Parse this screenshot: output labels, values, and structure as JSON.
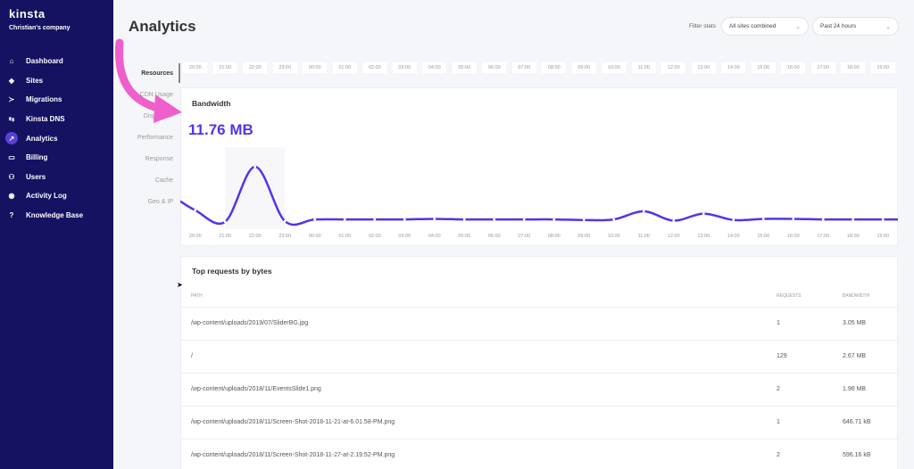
{
  "brand": {
    "logo": "kinsta",
    "company": "Christian's company"
  },
  "sidebar": {
    "items": [
      {
        "label": "Dashboard",
        "icon": "home-icon",
        "glyph": "⌂"
      },
      {
        "label": "Sites",
        "icon": "layers-icon",
        "glyph": "◈"
      },
      {
        "label": "Migrations",
        "icon": "migrate-icon",
        "glyph": "≻"
      },
      {
        "label": "Kinsta DNS",
        "icon": "dns-icon",
        "glyph": "⇆"
      },
      {
        "label": "Analytics",
        "icon": "analytics-icon",
        "glyph": "↗",
        "active": true
      },
      {
        "label": "Billing",
        "icon": "billing-icon",
        "glyph": "▭"
      },
      {
        "label": "Users",
        "icon": "users-icon",
        "glyph": "⚇"
      },
      {
        "label": "Activity Log",
        "icon": "eye-icon",
        "glyph": "◉"
      },
      {
        "label": "Knowledge Base",
        "icon": "help-icon",
        "glyph": "?"
      }
    ]
  },
  "page": {
    "title": "Analytics"
  },
  "filters": {
    "label": "Filter stats",
    "site": "All sites combined",
    "period": "Past 24 hours"
  },
  "subnav": [
    "Resources",
    "CDN Usage",
    "Dispersion",
    "Performance",
    "Response",
    "Cache",
    "Geo & IP"
  ],
  "times": [
    "20:00",
    "21:00",
    "22:00",
    "23:00",
    "00:00",
    "01:00",
    "02:00",
    "03:00",
    "04:00",
    "05:00",
    "06:00",
    "07:00",
    "08:00",
    "09:00",
    "10:00",
    "11:00",
    "12:00",
    "13:00",
    "14:00",
    "15:00",
    "16:00",
    "17:00",
    "18:00",
    "19:00"
  ],
  "bandwidth": {
    "title": "Bandwidth",
    "value": "11.76 MB"
  },
  "chart_data": {
    "type": "line",
    "x": [
      "20:00",
      "21:00",
      "22:00",
      "23:00",
      "00:00",
      "01:00",
      "02:00",
      "03:00",
      "04:00",
      "05:00",
      "06:00",
      "07:00",
      "08:00",
      "09:00",
      "10:00",
      "11:00",
      "12:00",
      "13:00",
      "14:00",
      "15:00",
      "16:00",
      "17:00",
      "18:00",
      "19:00"
    ],
    "series": [
      {
        "values": [
          0.22,
          0.02,
          0.97,
          0.03,
          0.06,
          0.06,
          0.06,
          0.06,
          0.07,
          0.06,
          0.06,
          0.06,
          0.06,
          0.05,
          0.06,
          0.2,
          0.04,
          0.16,
          0.05,
          0.07,
          0.07,
          0.06,
          0.06,
          0.06
        ]
      }
    ],
    "color": "#5333ed"
  },
  "requests": {
    "title": "Top requests by bytes",
    "columns": [
      "PATH",
      "REQUESTS",
      "BANDWIDTH"
    ],
    "rows": [
      {
        "path": "/wp-content/uploads/2019/07/SliderBG.jpg",
        "requests": "1",
        "bandwidth": "3.05 MB"
      },
      {
        "path": "/",
        "requests": "129",
        "bandwidth": "2.67 MB"
      },
      {
        "path": "/wp-content/uploads/2018/11/EventsSlide1.png",
        "requests": "2",
        "bandwidth": "1.96 MB"
      },
      {
        "path": "/wp-content/uploads/2018/11/Screen-Shot-2018-11-21-at-6.01.58-PM.png",
        "requests": "1",
        "bandwidth": "646.71 kB"
      },
      {
        "path": "/wp-content/uploads/2018/11/Screen-Shot-2018-11-27-at-2.19.52-PM.png",
        "requests": "2",
        "bandwidth": "596.16 kB"
      }
    ]
  }
}
